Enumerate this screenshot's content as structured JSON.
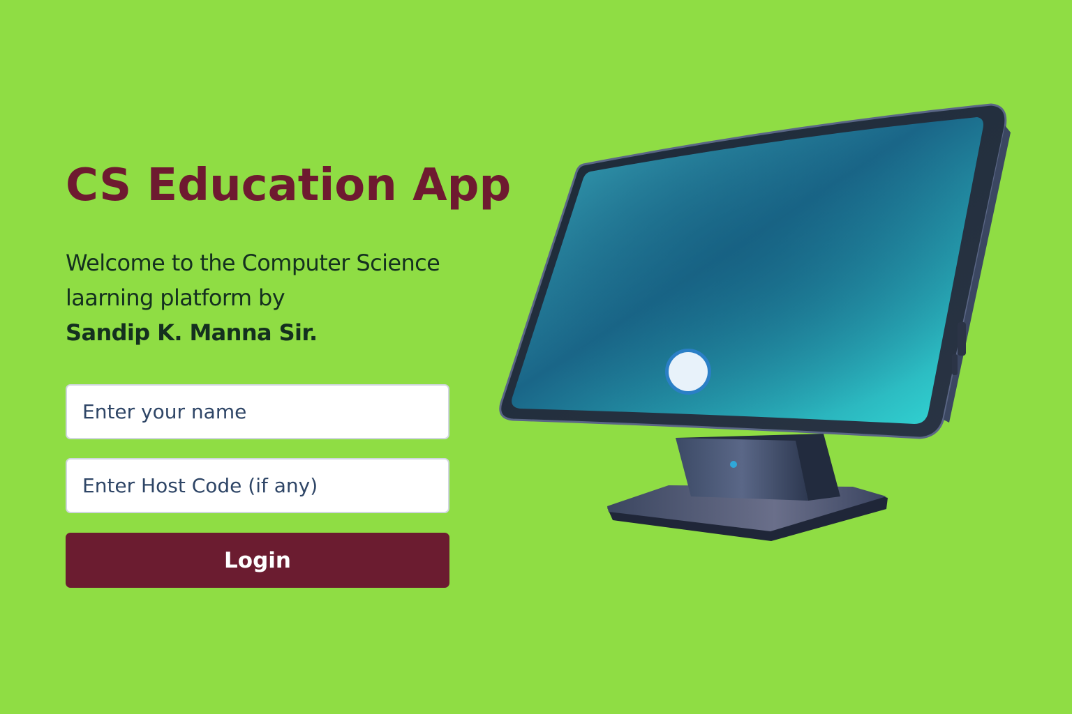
{
  "app": {
    "title": "CS Education App",
    "welcome_line1": "Welcome to the Computer Science",
    "welcome_line2": "laarning platform by",
    "welcome_author": "Sandip K. Manna Sir."
  },
  "form": {
    "name_placeholder": "Enter your name",
    "name_value": "",
    "host_code_placeholder": "Enter Host Code (if any)",
    "host_code_value": "",
    "login_label": "Login"
  },
  "illustration": {
    "icon": "monitor-icon"
  },
  "colors": {
    "background": "#8fdd44",
    "brand": "#6e1a30",
    "button": "#6b1c30",
    "text": "#14301f",
    "screen": "#1a8aa0"
  }
}
